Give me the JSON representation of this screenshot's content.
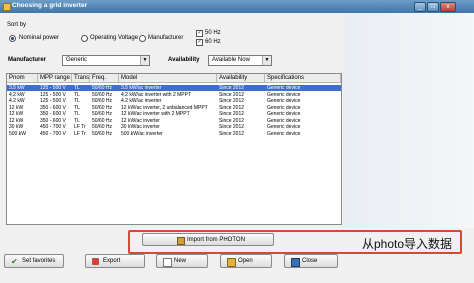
{
  "window": {
    "title": "Choosing a grid inverter",
    "min_glyph": "_",
    "max_glyph": "□",
    "close_glyph": "x"
  },
  "sort": {
    "label": "Sort by",
    "options": [
      "Nominal power",
      "Operating Voltage",
      "Manufacturer"
    ],
    "selected": "Nominal power"
  },
  "frequency": {
    "items": [
      {
        "label": "50 Hz",
        "checked": true
      },
      {
        "label": "60 Hz",
        "checked": true
      }
    ]
  },
  "manufacturer": {
    "label": "Manufacturer",
    "value": "Generic"
  },
  "availability": {
    "label": "Availability",
    "value": "Available Now"
  },
  "table": {
    "headers": [
      "Pnom",
      "MPP range",
      "Transf",
      "Freq.",
      "Model",
      "Availability",
      "Specifications"
    ],
    "rows": [
      [
        "3.5 kW",
        "125 - 500 V",
        "TL",
        "50/60 Hz",
        "3.5 kW/ac inverter",
        "Since 2012",
        "Generic device"
      ],
      [
        "4.2 kW",
        "125 - 500 V",
        "TL",
        "50/60 Hz",
        "4.2 kW/ac inverter with 2 MPPT",
        "Since 2012",
        "Generic device"
      ],
      [
        "4.2 kW",
        "125 - 500 V",
        "TL",
        "50/60 Hz",
        "4.2 kW/ac inverter",
        "Since 2012",
        "Generic device"
      ],
      [
        "12 kW",
        "350 - 600 V",
        "TL",
        "50/60 Hz",
        "12 kW/ac inverter, 2 unbalanced MPPT",
        "Since 2012",
        "Generic device"
      ],
      [
        "12 kW",
        "350 - 600 V",
        "TL",
        "50/60 Hz",
        "12 kW/ac inverter with 2 MPPT",
        "Since 2012",
        "Generic device"
      ],
      [
        "12 kW",
        "350 - 600 V",
        "TL",
        "50/60 Hz",
        "12 kW/ac inverter",
        "Since 2012",
        "Generic device"
      ],
      [
        "30 kW",
        "450 - 700 V",
        "LF Tr",
        "50/60 Hz",
        "30 kW/ac inverter",
        "Since 2012",
        "Generic device"
      ],
      [
        "500 kW",
        "450 - 700 V",
        "LF Tr",
        "50/60 Hz",
        "500 kW/ac inverter",
        "Since 2012",
        "Generic device"
      ]
    ],
    "selected_row": 0
  },
  "import_button": {
    "label": "Import from PHOTON"
  },
  "callout": {
    "text": "从photo导入数据"
  },
  "buttons": [
    {
      "name": "set-favorites-button",
      "label": "Set favorites",
      "icon": "checkmark-icon"
    },
    {
      "name": "export-button",
      "label": "Export",
      "icon": "export-icon"
    },
    {
      "name": "new-button",
      "label": "New",
      "icon": "new-document-icon"
    },
    {
      "name": "open-button",
      "label": "Open",
      "icon": "open-document-icon"
    },
    {
      "name": "close-button",
      "label": "Close",
      "icon": "exit-door-icon"
    }
  ],
  "colors": {
    "selection": "#3c6fcf",
    "callout_border": "#d9473b",
    "titlebar": "#3f75a8"
  }
}
